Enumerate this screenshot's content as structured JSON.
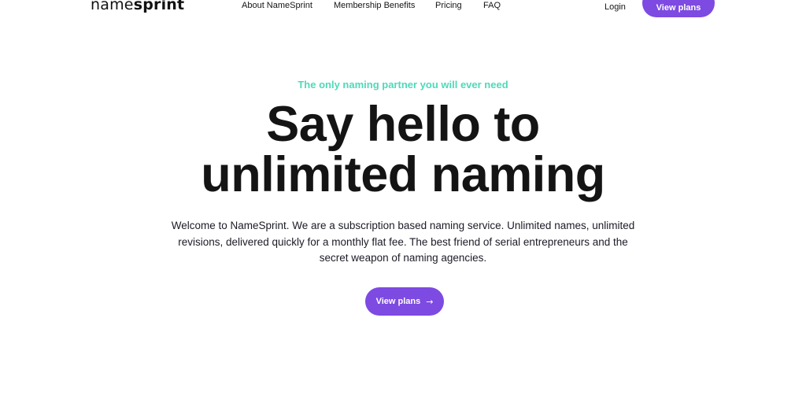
{
  "header": {
    "logo_light": "name",
    "logo_bold": "sprint",
    "nav": [
      {
        "label": "About NameSprint"
      },
      {
        "label": "Membership Benefits"
      },
      {
        "label": "Pricing"
      },
      {
        "label": "FAQ"
      }
    ],
    "login_label": "Login",
    "cta_label": "View plans"
  },
  "hero": {
    "eyebrow": "The only naming partner you will ever need",
    "headline_line1": "Say hello to",
    "headline_line2": "unlimited naming",
    "intro": "Welcome to NameSprint. We are a subscription based naming service. Unlimited names, unlimited revisions, delivered quickly for a monthly flat fee. The best friend of serial entrepreneurs and the secret weapon of naming agencies.",
    "cta_label": "View plans",
    "cta_icon": "arrow-right-icon"
  },
  "colors": {
    "accent": "#7d4ae2",
    "eyebrow": "#4fd9b9",
    "text": "#141414"
  }
}
